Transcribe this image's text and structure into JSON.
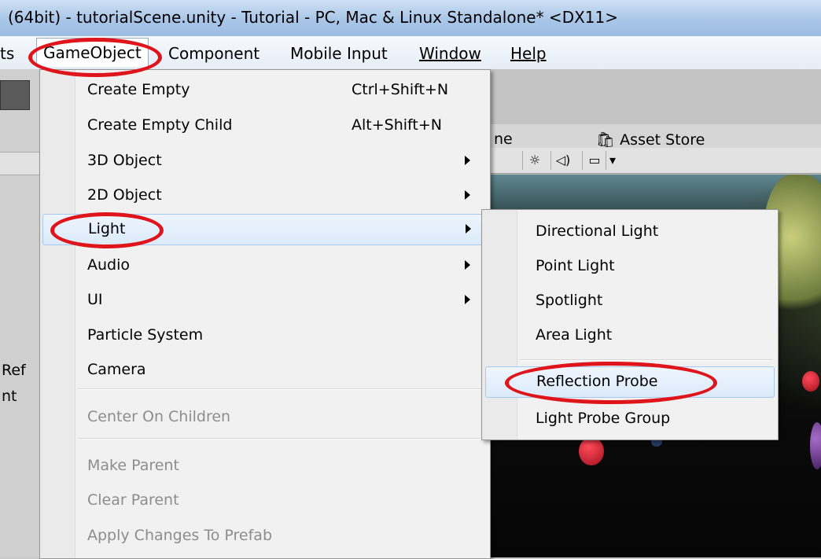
{
  "window": {
    "title": "(64bit) - tutorialScene.unity - Tutorial - PC, Mac & Linux Standalone* <DX11>"
  },
  "menubar": {
    "items": [
      {
        "label": "ts"
      },
      {
        "label": "GameObject"
      },
      {
        "label": "Component"
      },
      {
        "label": "Mobile Input"
      },
      {
        "label": "Window"
      },
      {
        "label": "Help"
      }
    ]
  },
  "background": {
    "left_text_1": "Ref",
    "left_text_2": "nt",
    "tab_partial": "ne",
    "asset_store_tab": "Asset Store"
  },
  "gameobject_menu": {
    "items": [
      {
        "label": "Create Empty",
        "shortcut": "Ctrl+Shift+N"
      },
      {
        "label": "Create Empty Child",
        "shortcut": "Alt+Shift+N"
      },
      {
        "label": "3D Object"
      },
      {
        "label": "2D Object"
      },
      {
        "label": "Light"
      },
      {
        "label": "Audio"
      },
      {
        "label": "UI"
      },
      {
        "label": "Particle System"
      },
      {
        "label": "Camera"
      },
      {
        "label": "Center On Children"
      },
      {
        "label": "Make Parent"
      },
      {
        "label": "Clear Parent"
      },
      {
        "label": "Apply Changes To Prefab"
      }
    ]
  },
  "light_submenu": {
    "items": [
      {
        "label": "Directional Light"
      },
      {
        "label": "Point Light"
      },
      {
        "label": "Spotlight"
      },
      {
        "label": "Area Light"
      },
      {
        "label": "Reflection Probe"
      },
      {
        "label": "Light Probe Group"
      }
    ]
  },
  "colors": {
    "annotation": "#e0141b",
    "highlight_border": "#a7c9ef",
    "disabled_text": "#8d8d8d"
  }
}
